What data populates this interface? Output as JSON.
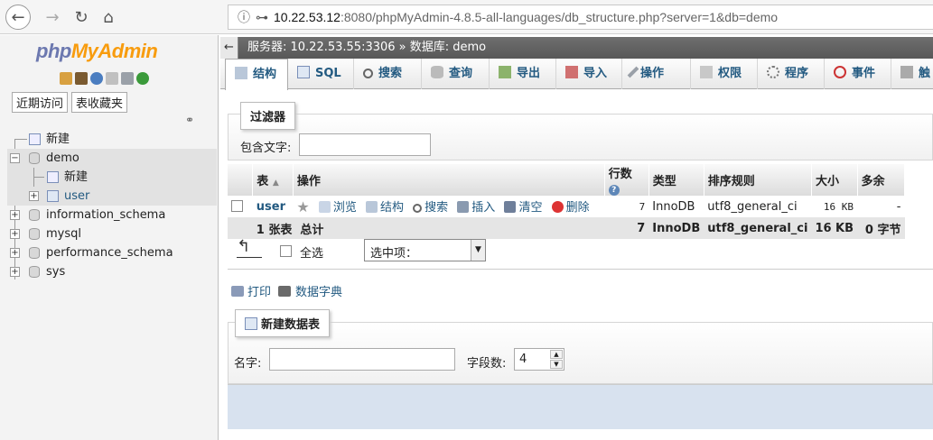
{
  "browser": {
    "url_host": "10.22.53.12",
    "url_rest": ":8080/phpMyAdmin-4.8.5-all-languages/db_structure.php?server=1&db=demo"
  },
  "leftnav": {
    "logo_php": "php",
    "logo_my": "MyAdmin",
    "tab_recent": "近期访问",
    "tab_favorites": "表收藏夹",
    "tree": {
      "new": "新建",
      "demo": "demo",
      "demo_new": "新建",
      "user": "user",
      "information_schema": "information_schema",
      "mysql": "mysql",
      "performance_schema": "performance_schema",
      "sys": "sys"
    }
  },
  "main": {
    "breadcrumb": "服务器: 10.22.53.55:3306 » 数据库: demo",
    "tabs": [
      "结构",
      "SQL",
      "搜索",
      "查询",
      "导出",
      "导入",
      "操作",
      "权限",
      "程序",
      "事件",
      "触"
    ],
    "filter": {
      "legend": "过滤器",
      "label": "包含文字:",
      "value": ""
    },
    "table": {
      "headers": [
        "表",
        "操作",
        "行数",
        "类型",
        "排序规则",
        "大小",
        "多余"
      ],
      "row": {
        "name": "user",
        "actions": [
          "浏览",
          "结构",
          "搜索",
          "插入",
          "清空",
          "删除"
        ],
        "rows": "7",
        "type": "InnoDB",
        "collation": "utf8_general_ci",
        "size": "16 KB",
        "overhead": "-"
      },
      "total": {
        "count": "1 张表",
        "label": "总计",
        "rows": "7",
        "type": "InnoDB",
        "collation": "utf8_general_ci",
        "size": "16 KB",
        "overhead": "0 字节"
      }
    },
    "select_all": "全选",
    "with_selected": "选中项：",
    "print": "打印",
    "data_dict": "数据字典",
    "create": {
      "legend": "新建数据表",
      "name_label": "名字:",
      "name_value": "",
      "fields_label": "字段数:",
      "fields_value": "4"
    }
  }
}
